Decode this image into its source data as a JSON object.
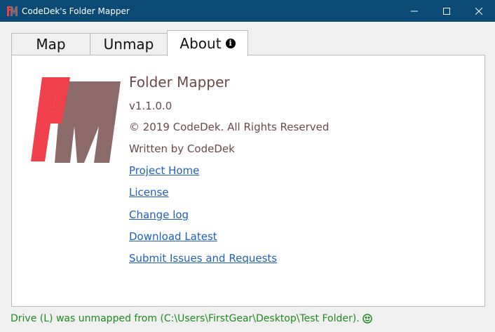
{
  "window": {
    "title": "CodeDek's Folder Mapper"
  },
  "tabs": [
    {
      "label": "Map"
    },
    {
      "label": "Unmap"
    },
    {
      "label": "About"
    }
  ],
  "about": {
    "app_name": "Folder Mapper",
    "version": "v1.1.0.0",
    "copyright": "© 2019 CodeDek. All Rights Reserved",
    "author": "Written by CodeDek",
    "links": [
      {
        "label": "Project Home"
      },
      {
        "label": "License"
      },
      {
        "label": "Change log"
      },
      {
        "label": "Download Latest"
      },
      {
        "label": "Submit Issues and Requests"
      }
    ]
  },
  "status": {
    "message": "Drive (L) was unmapped from (C:\\Users\\FirstGear\\Desktop\\Test Folder).",
    "icon": "smiley-icon"
  },
  "colors": {
    "titlebar": "#0b4a75",
    "logo_red": "#f0404c",
    "logo_gray": "#8c6a6a",
    "link": "#1f5fbf",
    "status": "#1f8a1f"
  }
}
